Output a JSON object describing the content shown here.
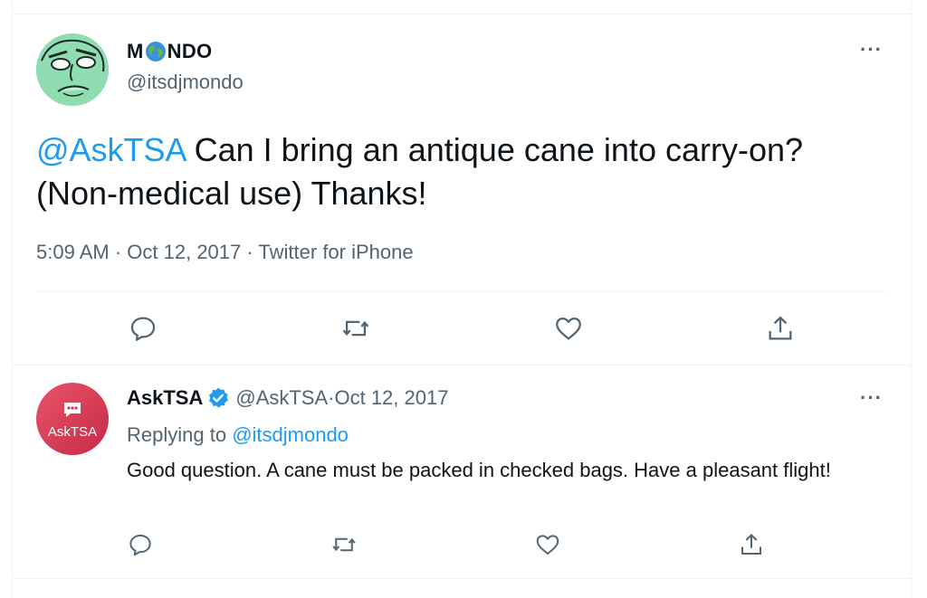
{
  "tweet": {
    "author_name_left": "M",
    "author_name_right": "NDO",
    "author_handle": "@itsdjmondo",
    "mention": "@AskTSA",
    "text": " Can I bring an antique cane into carry-on? (Non-medical use) Thanks!",
    "time": "5:09 AM",
    "date": "Oct 12, 2017",
    "source": "Twitter for iPhone",
    "meta_separator": " · ",
    "more_label": "···"
  },
  "reply": {
    "author_name": "AskTSA",
    "avatar_label": "AskTSA",
    "author_handle": "@AskTSA",
    "date_separator": " · ",
    "date": "Oct 12, 2017",
    "replying_prefix": "Replying to ",
    "replying_handle": "@itsdjmondo",
    "text": "Good question. A cane must be packed in checked bags. Have a pleasant flight!",
    "more_label": "···"
  },
  "icons": {
    "reply": "reply-icon",
    "retweet": "retweet-icon",
    "like": "heart-icon",
    "share": "share-icon",
    "verified": "verified-badge-icon"
  },
  "colors": {
    "link": "#1d9bf0",
    "secondary_text": "#536471",
    "divider": "#eff3f4"
  }
}
